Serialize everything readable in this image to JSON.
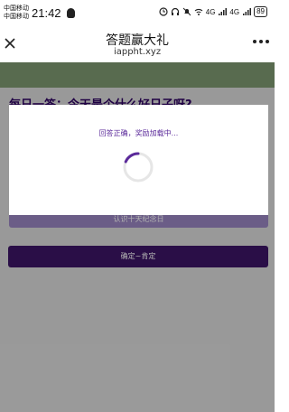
{
  "status_bar": {
    "carrier1": "中国移动",
    "carrier2": "中国移动",
    "time": "21:42",
    "network1": "4G",
    "network2": "4G",
    "battery": "89"
  },
  "nav": {
    "title": "答题赢大礼",
    "subtitle": "iappht.xyz",
    "close_icon": "close-icon",
    "more_icon": "more-icon"
  },
  "question": {
    "text": "每日一答：今天是个什么好日子呀?"
  },
  "options": [
    {
      "label": "认识十天纪念日"
    }
  ],
  "confirm_label": "确定~肯定",
  "modal": {
    "message": "回答正确，奖励加载中..."
  },
  "colors": {
    "accent": "#5b2a9a",
    "button_dark": "#3d1566",
    "band_green": "#7f9a72"
  }
}
